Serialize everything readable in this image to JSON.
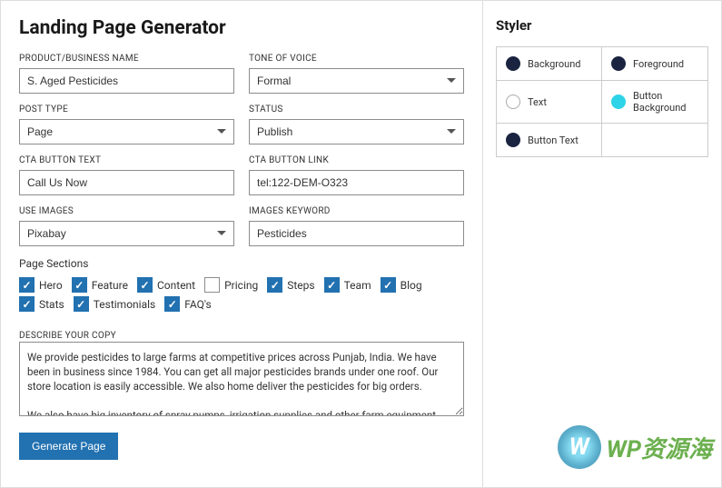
{
  "main": {
    "title": "Landing Page Generator",
    "fields": {
      "product_name": {
        "label": "PRODUCT/BUSINESS NAME",
        "value": "S. Aged Pesticides"
      },
      "tone": {
        "label": "TONE OF VOICE",
        "value": "Formal"
      },
      "post_type": {
        "label": "POST TYPE",
        "value": "Page"
      },
      "status": {
        "label": "STATUS",
        "value": "Publish"
      },
      "cta_text": {
        "label": "CTA BUTTON TEXT",
        "value": "Call Us Now"
      },
      "cta_link": {
        "label": "CTA BUTTON LINK",
        "value": "tel:122-DEM-O323"
      },
      "use_images": {
        "label": "USE IMAGES",
        "value": "Pixabay"
      },
      "images_keyword": {
        "label": "IMAGES KEYWORD",
        "value": "Pesticides"
      }
    },
    "sections": {
      "label": "Page Sections",
      "items": [
        {
          "label": "Hero",
          "checked": true
        },
        {
          "label": "Feature",
          "checked": true
        },
        {
          "label": "Content",
          "checked": true
        },
        {
          "label": "Pricing",
          "checked": false
        },
        {
          "label": "Steps",
          "checked": true
        },
        {
          "label": "Team",
          "checked": true
        },
        {
          "label": "Blog",
          "checked": true
        },
        {
          "label": "Stats",
          "checked": true
        },
        {
          "label": "Testimonials",
          "checked": true
        },
        {
          "label": "FAQ's",
          "checked": true
        }
      ]
    },
    "describe": {
      "label": "DESCRIBE YOUR COPY",
      "value": "We provide pesticides to large farms at competitive prices across Punjab, India. We have been in business since 1984. You can get all major pesticides brands under one roof. Our store location is easily accessible. We also home deliver the pesticides for big orders.\n\nWe also have big inventory of spray pumps, irrigation supplies and other farm equipment."
    },
    "submit": "Generate Page"
  },
  "styler": {
    "title": "Styler",
    "items": [
      {
        "label": "Background",
        "swatch": "dark"
      },
      {
        "label": "Foreground",
        "swatch": "dark"
      },
      {
        "label": "Text",
        "swatch": "outline"
      },
      {
        "label": "Button Background",
        "swatch": "cyan"
      },
      {
        "label": "Button Text",
        "swatch": "dark"
      }
    ]
  },
  "watermark": {
    "logo": "W",
    "text": "WP资源海"
  }
}
